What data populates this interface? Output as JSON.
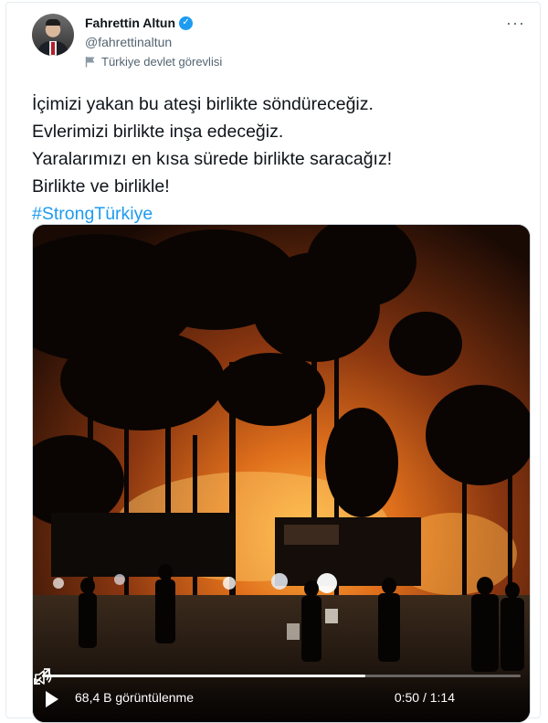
{
  "author": {
    "display_name": "Fahrettin Altun",
    "handle": "@fahrettinaltun",
    "account_label": "Türkiye devlet görevlisi",
    "verified": true,
    "avatar_icon": "avatar-photo"
  },
  "menu": {
    "more_label": "···"
  },
  "tweet": {
    "lines": [
      "İçimizi yakan bu ateşi birlikte söndüreceğiz.",
      "Evlerimizi birlikte inşa edeceğiz.",
      "Yaralarımızı en kısa sürede birlikte saracağız!",
      "Birlikte ve birlikle!"
    ],
    "hashtag": "#StrongTürkiye"
  },
  "video": {
    "views": "68,4 B görüntülenme",
    "time": "0:50 / 1:14",
    "progress": 0.676,
    "icons": {
      "play": "play-icon",
      "volume": "volume-icon",
      "fullscreen": "fullscreen-icon"
    }
  },
  "colors": {
    "accent": "#1d9bf0",
    "text": "#0f1419",
    "muted": "#536471",
    "fire": "#f08a1c"
  }
}
